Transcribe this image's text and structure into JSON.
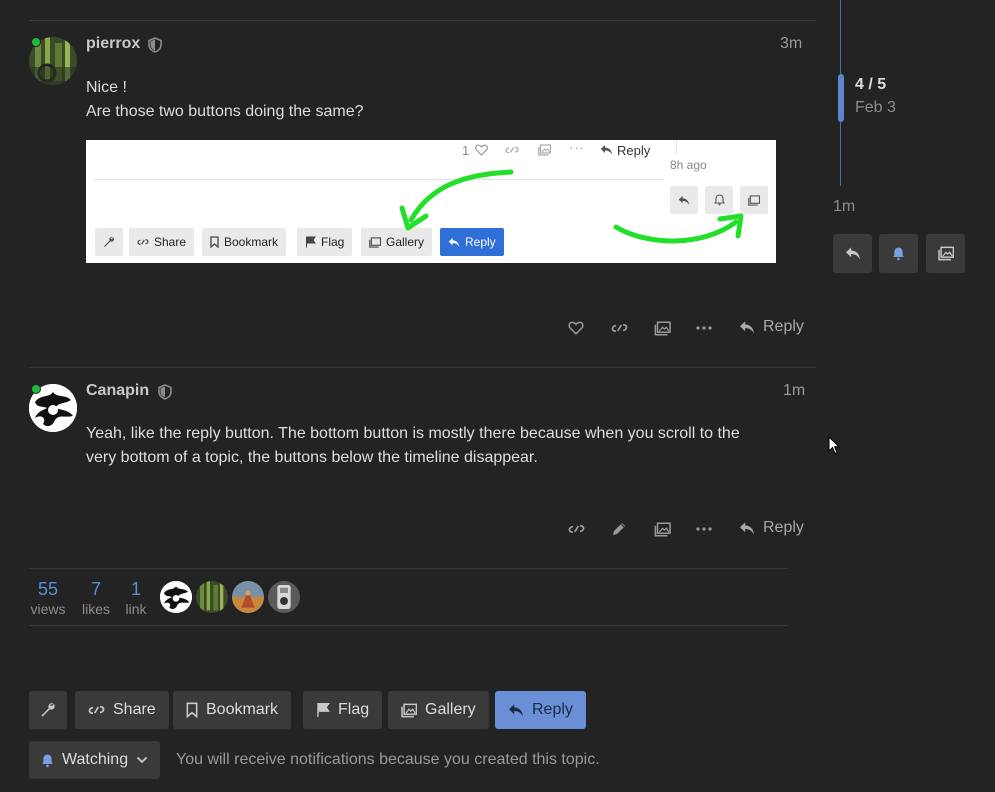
{
  "posts": [
    {
      "username": "pierrox",
      "time": "3m",
      "lines": [
        "Nice !",
        "Are those two buttons doing the same?"
      ],
      "reply_label": "Reply"
    },
    {
      "username": "Canapin",
      "time": "1m",
      "lines": [
        "Yeah, like the reply button. The bottom button is mostly there because when you scroll to the",
        "very bottom of a topic, the buttons below the timeline disappear."
      ],
      "reply_label": "Reply"
    }
  ],
  "embedded_screenshot": {
    "like_count": "1",
    "reply_label": "Reply",
    "time": "8h ago",
    "buttons": {
      "share": "Share",
      "bookmark": "Bookmark",
      "flag": "Flag",
      "gallery": "Gallery",
      "reply": "Reply"
    }
  },
  "stats": [
    {
      "num": "55",
      "label": "views"
    },
    {
      "num": "7",
      "label": "likes"
    },
    {
      "num": "1",
      "label": "link"
    }
  ],
  "footer_buttons": {
    "share": "Share",
    "bookmark": "Bookmark",
    "flag": "Flag",
    "gallery": "Gallery",
    "reply": "Reply"
  },
  "notification": {
    "level": "Watching",
    "reason": "You will receive notifications because you created this topic."
  },
  "timeline": {
    "position": "4 / 5",
    "date": "Feb 3",
    "last_activity": "1m"
  },
  "colors": {
    "accent": "#5b86d0",
    "online": "#1cbd3a",
    "primary_button": "#6b8fd6",
    "background": "#232323"
  }
}
